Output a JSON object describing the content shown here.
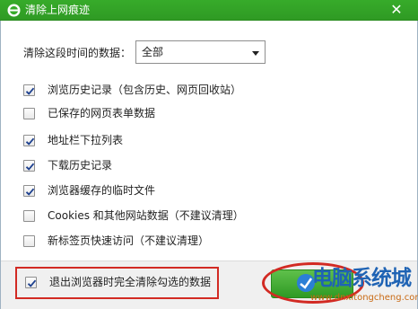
{
  "window": {
    "title": "清除上网痕迹",
    "close_glyph": "✕"
  },
  "range": {
    "label": "清除这段时间的数据：",
    "selected": "全部"
  },
  "options": [
    {
      "label": "浏览历史记录（包含历史、网页回收站）",
      "checked": true
    },
    {
      "label": "已保存的网页表单数据",
      "checked": false
    },
    {
      "label": "地址栏下拉列表",
      "checked": true
    },
    {
      "label": "下载历史记录",
      "checked": true
    },
    {
      "label": "浏览器缓存的临时文件",
      "checked": true
    },
    {
      "label": "Cookies 和其他网站数据（不建议清理）",
      "checked": false
    },
    {
      "label": "新标签页快速访问（不建议清理）",
      "checked": false
    }
  ],
  "footer": {
    "exit_clear_label": "退出浏览器时完全清除勾选的数据",
    "exit_clear_checked": true
  },
  "watermark": {
    "text": "电脑系统城",
    "url": "www.dnxitongcheng.com"
  },
  "colors": {
    "title_bar": "#37ab2a",
    "highlight": "#d22a23",
    "watermark": "#1f63b4"
  }
}
